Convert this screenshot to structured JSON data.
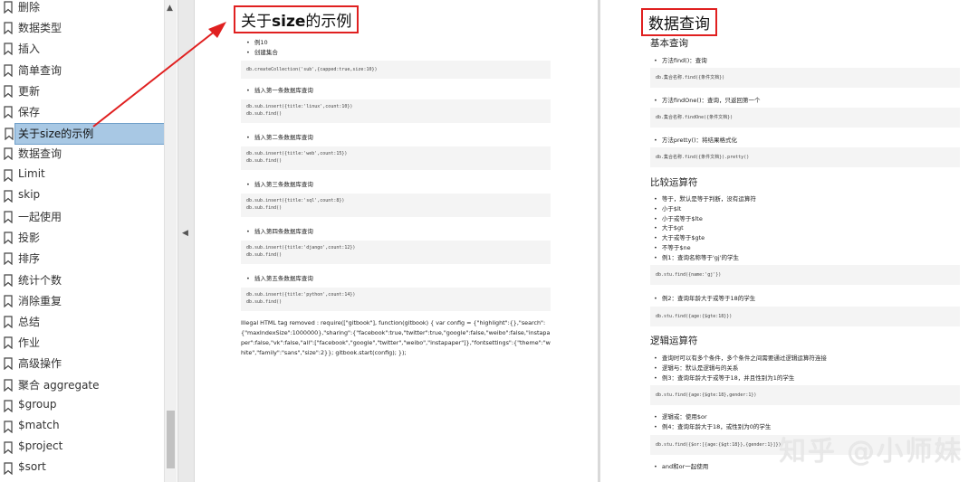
{
  "sidebar": {
    "items": [
      {
        "label": "删除"
      },
      {
        "label": "数据类型"
      },
      {
        "label": "插入"
      },
      {
        "label": "简单查询"
      },
      {
        "label": "更新"
      },
      {
        "label": "保存"
      },
      {
        "label": "关于size的示例",
        "active": true
      },
      {
        "label": "数据查询"
      },
      {
        "label": "Limit"
      },
      {
        "label": "skip"
      },
      {
        "label": "一起使用"
      },
      {
        "label": "投影"
      },
      {
        "label": "排序"
      },
      {
        "label": "统计个数"
      },
      {
        "label": "消除重复"
      },
      {
        "label": "总结"
      },
      {
        "label": "作业"
      },
      {
        "label": "高级操作"
      },
      {
        "label": "聚合 aggregate"
      },
      {
        "label": "$group"
      },
      {
        "label": "$match"
      },
      {
        "label": "$project"
      },
      {
        "label": "$sort"
      }
    ]
  },
  "left_page": {
    "title_pre": "关于",
    "title_bold": "size",
    "title_post": "的示例",
    "bullets_top": [
      "例10",
      "创建集合"
    ],
    "code1": "db.createCollection('sub',{capped:true,size:10})",
    "steps": [
      {
        "label": "插入第一条数据库查询",
        "code": "db.sub.insert({title:'linux',count:10})\ndb.sub.find()"
      },
      {
        "label": "插入第二条数据库查询",
        "code": "db.sub.insert({title:'web',count:15})\ndb.sub.find()"
      },
      {
        "label": "插入第三条数据库查询",
        "code": "db.sub.insert({title:'sql',count:8})\ndb.sub.find()"
      },
      {
        "label": "插入第四条数据库查询",
        "code": "db.sub.insert({title:'django',count:12})\ndb.sub.find()"
      },
      {
        "label": "插入第五条数据库查询",
        "code": "db.sub.insert({title:'python',count:14})\ndb.sub.find()"
      }
    ],
    "footer": "Illegal HTML tag removed : require([\"gitbook\"], function(gitbook) { var config = {\"highlight\":{},\"search\":{\"maxIndexSize\":1000000},\"sharing\":{\"facebook\":true,\"twitter\":true,\"google\":false,\"weibo\":false,\"instapaper\":false,\"vk\":false,\"all\":[\"facebook\",\"google\",\"twitter\",\"weibo\",\"instapaper\"]},\"fontsettings\":{\"theme\":\"white\",\"family\":\"sans\",\"size\":2}}; gitbook.start(config); });"
  },
  "right_page": {
    "title": "数据查询",
    "basic": {
      "heading": "基本查询",
      "b1": "方法find()：查询",
      "c1": "db.集合名称.find({条件文档})",
      "b2": "方法findOne()：查询，只返回第一个",
      "c2": "db.集合名称.findOne({条件文档})",
      "b3": "方法pretty()：将结果格式化",
      "c3": "db.集合名称.find({条件文档}).pretty()"
    },
    "compare": {
      "heading": "比较运算符",
      "items": [
        "等于，默认是等于判断，没有运算符",
        "小于$lt",
        "小于或等于$lte",
        "大于$gt",
        "大于或等于$gte",
        "不等于$ne",
        "例1：查询名称等于'gj'的学生"
      ],
      "c1": "db.stu.find({name:'gj'})",
      "b2": "例2：查询年龄大于或等于18的学生",
      "c2": "db.stu.find({age:{$gte:18}})"
    },
    "logic": {
      "heading": "逻辑运算符",
      "items": [
        "查询时可以有多个条件，多个条件之间需要通过逻辑运算符连接",
        "逻辑与：默认是逻辑与的关系",
        "例3：查询年龄大于或等于18，并且性别为1的学生"
      ],
      "c1": "db.stu.find({age:{$gte:18},gender:1})",
      "items2": [
        "逻辑或：使用$or",
        "例4：查询年龄大于18，或性别为0的学生"
      ],
      "c2": "db.stu.find({$or:[{age:{$gt:18}},{gender:1}]})",
      "b_last": "and和or一起使用"
    }
  },
  "watermark": "知乎 @小师妹",
  "colors": {
    "highlight": "#e02020",
    "active_bg": "#a8c8e4"
  }
}
